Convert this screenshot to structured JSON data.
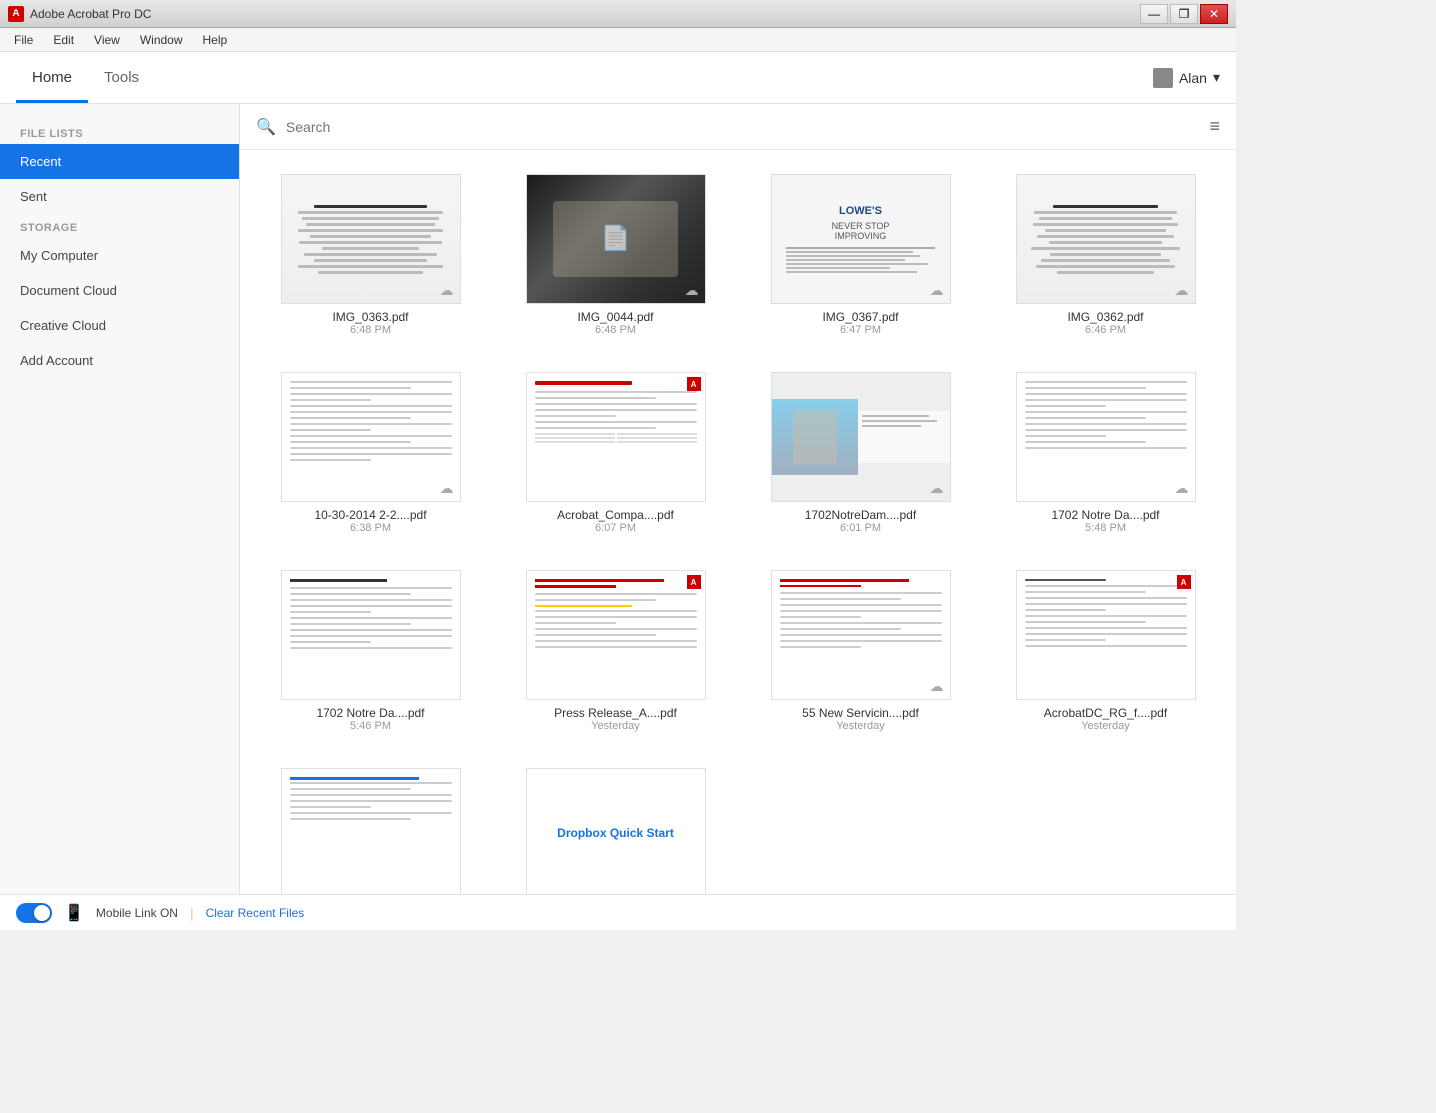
{
  "app": {
    "title": "Adobe Acrobat Pro DC",
    "icon_label": "A"
  },
  "titlebar": {
    "minimize": "—",
    "restore": "❐",
    "close": "✕"
  },
  "menubar": {
    "items": [
      "File",
      "Edit",
      "View",
      "Window",
      "Help"
    ]
  },
  "header": {
    "tabs": [
      "Home",
      "Tools"
    ],
    "active_tab": "Home",
    "user": "Alan"
  },
  "search": {
    "placeholder": "Search"
  },
  "sidebar": {
    "file_lists_label": "FILE LISTS",
    "file_lists_items": [
      "Recent",
      "Sent"
    ],
    "storage_label": "STORAGE",
    "storage_items": [
      "My Computer",
      "Document Cloud",
      "Creative Cloud",
      "Add Account"
    ],
    "active_item": "Recent"
  },
  "files": [
    {
      "name": "IMG_0363.pdf",
      "time": "6:48 PM",
      "has_cloud": true,
      "has_adobe": false,
      "type": "receipt-brown"
    },
    {
      "name": "IMG_0044.pdf",
      "time": "6:48 PM",
      "has_cloud": true,
      "has_adobe": false,
      "type": "dark-photo"
    },
    {
      "name": "IMG_0367.pdf",
      "time": "6:47 PM",
      "has_cloud": true,
      "has_adobe": false,
      "type": "receipt-lowes"
    },
    {
      "name": "IMG_0362.pdf",
      "time": "6:46 PM",
      "has_cloud": true,
      "has_adobe": false,
      "type": "receipt-brown2"
    },
    {
      "name": "10-30-2014 2-2....pdf",
      "time": "6:38 PM",
      "has_cloud": true,
      "has_adobe": false,
      "type": "doc-plain"
    },
    {
      "name": "Acrobat_Compa....pdf",
      "time": "6:07 PM",
      "has_cloud": false,
      "has_adobe": true,
      "type": "doc-adobe"
    },
    {
      "name": "1702NotreDam....pdf",
      "time": "6:01 PM",
      "has_cloud": true,
      "has_adobe": false,
      "type": "doc-photo"
    },
    {
      "name": "1702 Notre Da....pdf",
      "time": "5:48 PM",
      "has_cloud": true,
      "has_adobe": false,
      "type": "doc-text"
    },
    {
      "name": "1702 Notre Da....pdf",
      "time": "5:46 PM",
      "has_cloud": false,
      "has_adobe": false,
      "type": "doc-text2"
    },
    {
      "name": "Press Release_A....pdf",
      "time": "Yesterday",
      "has_cloud": false,
      "has_adobe": true,
      "type": "doc-press"
    },
    {
      "name": "55 New Servicin....pdf",
      "time": "Yesterday",
      "has_cloud": true,
      "has_adobe": false,
      "type": "doc-service"
    },
    {
      "name": "AcrobatDC_RG_f....pdf",
      "time": "Yesterday",
      "has_cloud": false,
      "has_adobe": true,
      "type": "doc-rg"
    },
    {
      "name": "Dropbox Quick Start",
      "time": "",
      "has_cloud": false,
      "has_adobe": false,
      "type": "doc-dropbox"
    }
  ],
  "bottombar": {
    "mobile_link_label": "Mobile Link ON",
    "separator": "|",
    "clear_label": "Clear Recent Files"
  }
}
